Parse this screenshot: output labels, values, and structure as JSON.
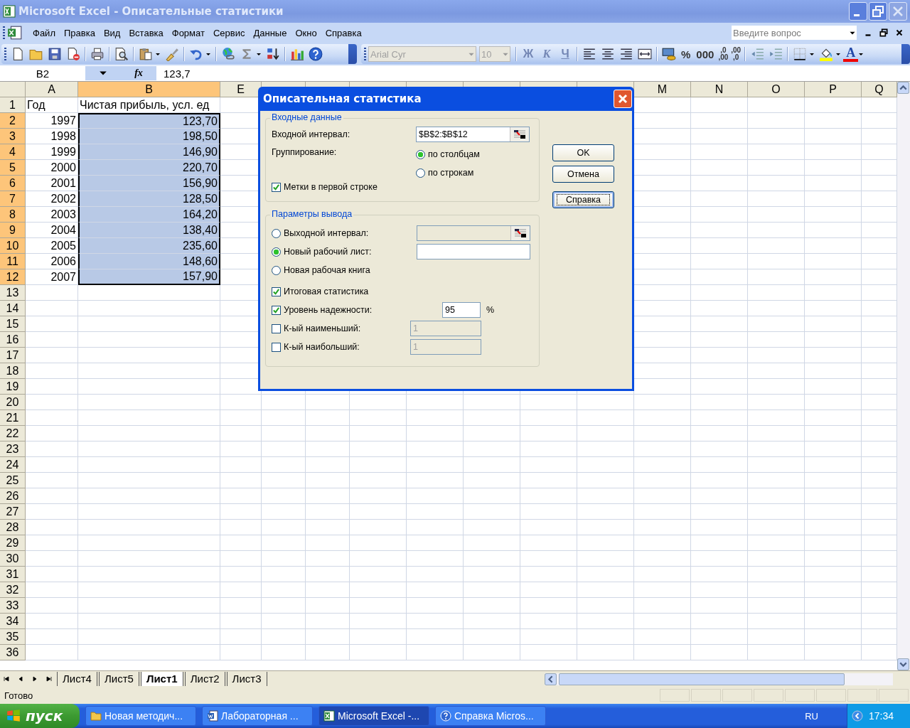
{
  "window": {
    "title": "Microsoft Excel - Описательные статистики"
  },
  "menu": [
    "Файл",
    "Правка",
    "Вид",
    "Вставка",
    "Формат",
    "Сервис",
    "Данные",
    "Окно",
    "Справка"
  ],
  "help_search": {
    "placeholder": "Введите вопрос"
  },
  "toolbar": {
    "font": "Arial Cyr",
    "font_size": "10",
    "style_buttons": [
      "Ж",
      "К",
      "Ч"
    ],
    "number_buttons": [
      "%",
      "000"
    ],
    "decimal_buttons": [
      {
        "top": ",0",
        "bottom": ",00"
      },
      {
        "top": ",00",
        "bottom": ",0"
      }
    ],
    "font_color_button": "A"
  },
  "formula_bar": {
    "name_box": "B2",
    "function_label": "fx",
    "value": "123,7"
  },
  "columns": [
    {
      "label": "A",
      "selected": false
    },
    {
      "label": "B",
      "selected": true
    },
    {
      "label": "E",
      "selected": false
    },
    {
      "label": "M",
      "selected": false
    },
    {
      "label": "N",
      "selected": false
    },
    {
      "label": "O",
      "selected": false
    },
    {
      "label": "P",
      "selected": false
    },
    {
      "label": "Q",
      "selected": false
    }
  ],
  "rows": [
    {
      "header": "1",
      "selected": false,
      "kind": "text",
      "cells": [
        "Год",
        "Чистая прибыль, усл. ед"
      ]
    },
    {
      "header": "2",
      "selected": true,
      "kind": "number",
      "cells": [
        "1997",
        "123,70"
      ]
    },
    {
      "header": "3",
      "selected": true,
      "kind": "number",
      "cells": [
        "1998",
        "198,50"
      ]
    },
    {
      "header": "4",
      "selected": true,
      "kind": "number",
      "cells": [
        "1999",
        "146,90"
      ]
    },
    {
      "header": "5",
      "selected": true,
      "kind": "number",
      "cells": [
        "2000",
        "220,70"
      ]
    },
    {
      "header": "6",
      "selected": true,
      "kind": "number",
      "cells": [
        "2001",
        "156,90"
      ]
    },
    {
      "header": "7",
      "selected": true,
      "kind": "number",
      "cells": [
        "2002",
        "128,50"
      ]
    },
    {
      "header": "8",
      "selected": true,
      "kind": "number",
      "cells": [
        "2003",
        "164,20"
      ]
    },
    {
      "header": "9",
      "selected": true,
      "kind": "number",
      "cells": [
        "2004",
        "138,40"
      ]
    },
    {
      "header": "10",
      "selected": true,
      "kind": "number",
      "cells": [
        "2005",
        "235,60"
      ]
    },
    {
      "header": "11",
      "selected": true,
      "kind": "number",
      "cells": [
        "2006",
        "148,60"
      ]
    },
    {
      "header": "12",
      "selected": true,
      "kind": "number",
      "cells": [
        "2007",
        "157,90"
      ]
    },
    {
      "header": "13",
      "selected": false
    },
    {
      "header": "14",
      "selected": false
    },
    {
      "header": "15",
      "selected": false
    },
    {
      "header": "16",
      "selected": false
    },
    {
      "header": "17",
      "selected": false
    },
    {
      "header": "18",
      "selected": false
    },
    {
      "header": "19",
      "selected": false
    },
    {
      "header": "20",
      "selected": false
    },
    {
      "header": "21",
      "selected": false
    },
    {
      "header": "22",
      "selected": false
    },
    {
      "header": "23",
      "selected": false
    },
    {
      "header": "24",
      "selected": false
    },
    {
      "header": "25",
      "selected": false
    },
    {
      "header": "26",
      "selected": false
    },
    {
      "header": "27",
      "selected": false
    },
    {
      "header": "28",
      "selected": false
    },
    {
      "header": "29",
      "selected": false
    },
    {
      "header": "30",
      "selected": false
    },
    {
      "header": "31",
      "selected": false
    },
    {
      "header": "32",
      "selected": false
    },
    {
      "header": "33",
      "selected": false
    },
    {
      "header": "34",
      "selected": false
    },
    {
      "header": "35",
      "selected": false
    },
    {
      "header": "36",
      "selected": false
    }
  ],
  "sheet_tabs": [
    {
      "label": "Лист4",
      "selected": false
    },
    {
      "label": "Лист5",
      "selected": false
    },
    {
      "label": "Лист1",
      "selected": true
    },
    {
      "label": "Лист2",
      "selected": false
    },
    {
      "label": "Лист3",
      "selected": false
    }
  ],
  "status_bar": {
    "text": "Готово"
  },
  "dialog": {
    "title": "Описательная статистика",
    "input_group": {
      "title": "Входные данные",
      "range_label": "Входной интервал:",
      "range_value": "$B$2:$B$12",
      "grouping_label": "Группирование:",
      "grouping": [
        {
          "label": "по столбцам",
          "selected": true
        },
        {
          "label": "по строкам",
          "selected": false
        }
      ],
      "labels_in_first_row": {
        "label": "Метки в первой строке",
        "checked": true
      }
    },
    "output_group": {
      "title": "Параметры вывода",
      "destinations": [
        {
          "label": "Выходной интервал:",
          "selected": false,
          "kind": "picker",
          "disabled": true
        },
        {
          "label": "Новый рабочий лист:",
          "selected": true,
          "kind": "text",
          "disabled": false
        },
        {
          "label": "Новая рабочая книга",
          "selected": false,
          "kind": "plain"
        }
      ],
      "options": [
        {
          "label": "Итоговая статистика",
          "checked": true,
          "kind": "plain"
        },
        {
          "label": "Уровень надежности:",
          "checked": true,
          "kind": "percent",
          "value": "95",
          "suffix": "%"
        },
        {
          "label": "К-ый наименьший:",
          "checked": false,
          "kind": "number",
          "value": "1"
        },
        {
          "label": "К-ый наибольший:",
          "checked": false,
          "kind": "number",
          "value": "1"
        }
      ]
    },
    "buttons": [
      {
        "label": "OK",
        "focused": false
      },
      {
        "label": "Отмена",
        "focused": false
      },
      {
        "label": "Справка",
        "focused": true
      }
    ]
  },
  "taskbar": {
    "start": "пуск",
    "tasks": [
      {
        "label": "Новая методич...",
        "kind": "folder",
        "selected": false
      },
      {
        "label": "Лабораторная ...",
        "kind": "word",
        "selected": false
      },
      {
        "label": "Microsoft Excel -...",
        "kind": "excel",
        "selected": true
      },
      {
        "label": "Справка Micros...",
        "kind": "help",
        "selected": false
      }
    ],
    "language": "RU",
    "clock": "17:34"
  }
}
